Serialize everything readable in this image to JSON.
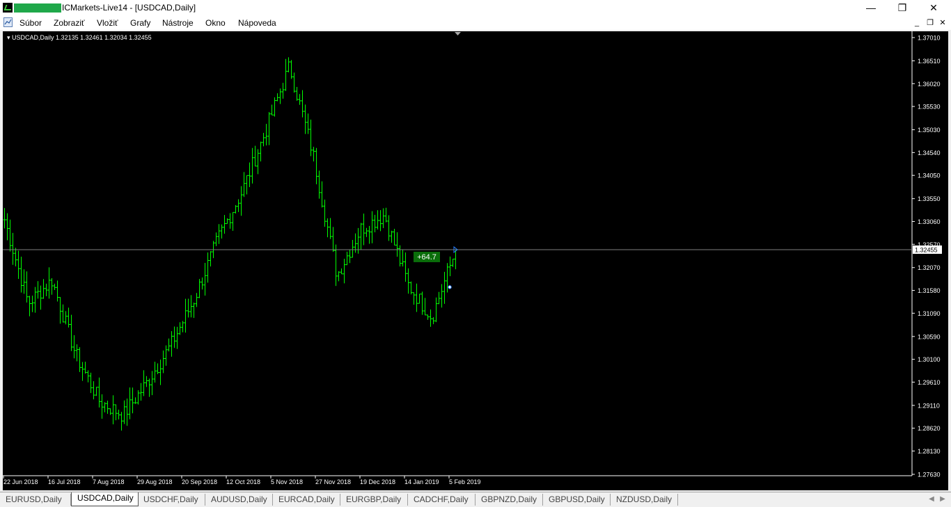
{
  "window": {
    "title": "ICMarkets-Live14 - [USDCAD,Daily]",
    "minimize": "—",
    "maximize": "❐",
    "close": "✕"
  },
  "menu": [
    "Súbor",
    "Zobraziť",
    "Vložiť",
    "Grafy",
    "Nástroje",
    "Okno",
    "Nápoveda"
  ],
  "mdi": {
    "minimize": "_",
    "restore": "❐",
    "close": "✕"
  },
  "chart": {
    "info": "USDCAD,Daily  1.32135 1.32461 1.32034 1.32455",
    "badge": "+64.7",
    "price_labels": [
      "1.37010",
      "1.36510",
      "1.36020",
      "1.35530",
      "1.35030",
      "1.34540",
      "1.34050",
      "1.33550",
      "1.33060",
      "1.32570",
      "1.32070",
      "1.31580",
      "1.31090",
      "1.30590",
      "1.30100",
      "1.29610",
      "1.29110",
      "1.28620",
      "1.28130",
      "1.27630"
    ],
    "current_price": "1.32455",
    "date_labels": [
      "22 Jun 2018",
      "16 Jul 2018",
      "7 Aug 2018",
      "29 Aug 2018",
      "20 Sep 2018",
      "12 Oct 2018",
      "5 Nov 2018",
      "27 Nov 2018",
      "19 Dec 2018",
      "14 Jan 2019",
      "5 Feb 2019"
    ],
    "colors": {
      "background": "#000000",
      "bars": "#00ff00",
      "grid_text": "#ffffff",
      "price_line": "#808080",
      "badge": "#0a6e0a"
    }
  },
  "chart_data": {
    "type": "line",
    "symbol": "USDCAD",
    "timeframe": "Daily",
    "ylim": [
      1.2763,
      1.3701
    ],
    "yticks": [
      1.3701,
      1.3651,
      1.3602,
      1.3553,
      1.3503,
      1.3454,
      1.3405,
      1.3355,
      1.3306,
      1.3257,
      1.3207,
      1.3158,
      1.3109,
      1.3059,
      1.301,
      1.2961,
      1.2911,
      1.2862,
      1.2813,
      1.2763
    ],
    "x": [
      "22 Jun 2018",
      "16 Jul 2018",
      "7 Aug 2018",
      "29 Aug 2018",
      "20 Sep 2018",
      "12 Oct 2018",
      "5 Nov 2018",
      "27 Nov 2018",
      "19 Dec 2018",
      "14 Jan 2019",
      "5 Feb 2019"
    ],
    "series": [
      {
        "values": [
          1.331,
          1.313,
          1.318,
          1.302,
          1.292,
          1.289,
          1.296,
          1.304,
          1.314,
          1.327,
          1.337,
          1.35,
          1.364,
          1.345,
          1.319,
          1.329,
          1.332,
          1.317,
          1.31,
          1.3245
        ]
      }
    ],
    "last": {
      "open": 1.32135,
      "high": 1.32461,
      "low": 1.32034,
      "close": 1.32455
    }
  },
  "tabs": [
    "EURUSD,Daily",
    "USDCAD,Daily",
    "USDCHF,Daily",
    "AUDUSD,Daily",
    "EURCAD,Daily",
    "EURGBP,Daily",
    "CADCHF,Daily",
    "GBPNZD,Daily",
    "GBPUSD,Daily",
    "NZDUSD,Daily"
  ],
  "active_tab": "USDCAD,Daily",
  "tab_scroll": {
    "left": "◀",
    "right": "▶"
  }
}
